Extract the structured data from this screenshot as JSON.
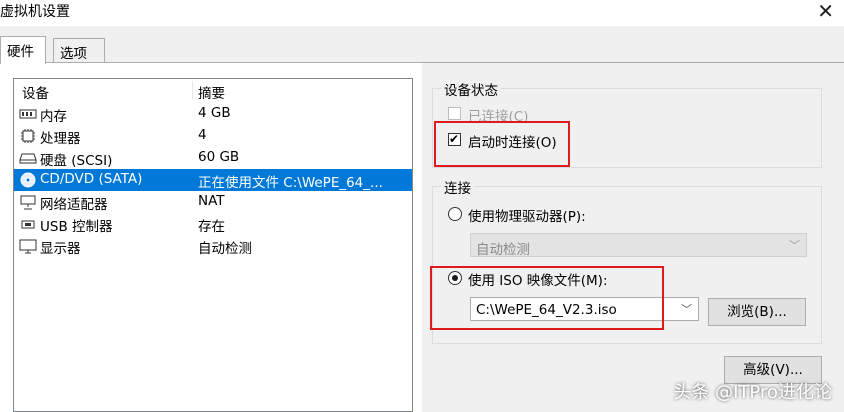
{
  "window": {
    "title": "虚拟机设置",
    "close_glyph": "✕"
  },
  "tabs": [
    {
      "label": "硬件",
      "active": true
    },
    {
      "label": "选项",
      "active": false
    }
  ],
  "device_list": {
    "columns": [
      "设备",
      "摘要"
    ],
    "rows": [
      {
        "icon": "memory-icon",
        "name": "内存",
        "summary": "4 GB",
        "selected": false
      },
      {
        "icon": "processor-icon",
        "name": "处理器",
        "summary": "4",
        "selected": false
      },
      {
        "icon": "harddisk-icon",
        "name": "硬盘 (SCSI)",
        "summary": "60 GB",
        "selected": false
      },
      {
        "icon": "cd-dvd-icon",
        "name": "CD/DVD (SATA)",
        "summary": "正在使用文件 C:\\WePE_64_...",
        "selected": true
      },
      {
        "icon": "network-adapter-icon",
        "name": "网络适配器",
        "summary": "NAT",
        "selected": false
      },
      {
        "icon": "usb-controller-icon",
        "name": "USB 控制器",
        "summary": "存在",
        "selected": false
      },
      {
        "icon": "display-icon",
        "name": "显示器",
        "summary": "自动检测",
        "selected": false
      }
    ]
  },
  "device_status": {
    "title": "设备状态",
    "connected_label": "已连接(C)",
    "connected_checked": false,
    "connect_at_power_on_label": "启动时连接(O)",
    "connect_at_power_on_checked": true
  },
  "connection": {
    "title": "连接",
    "physical_drive_label": "使用物理驱动器(P):",
    "physical_drive_selected": false,
    "physical_drive_value": "自动检测",
    "iso_label": "使用 ISO 映像文件(M):",
    "iso_selected": true,
    "iso_path": "C:\\WePE_64_V2.3.iso",
    "browse_label": "浏览(B)..."
  },
  "advanced_label": "高级(V)...",
  "watermark": "头条 @ITPro进化论",
  "colors": {
    "selection": "#0078d7",
    "highlight_box": "#e0191c"
  }
}
